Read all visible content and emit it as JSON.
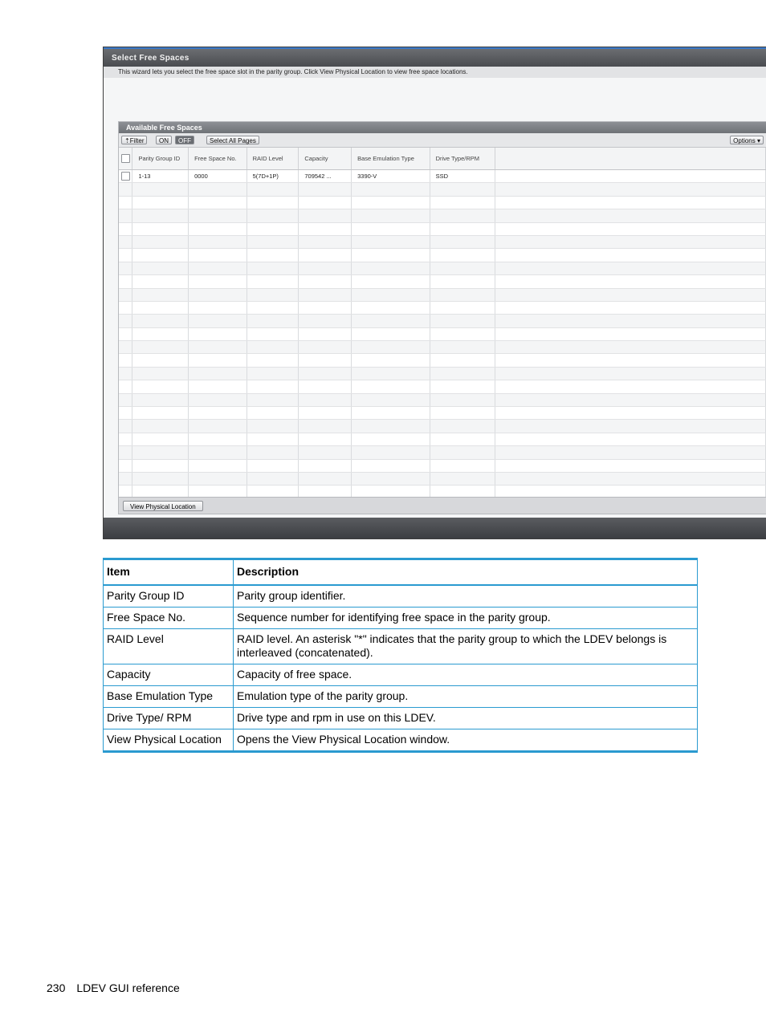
{
  "screenshot": {
    "window_title": "Select Free Spaces",
    "description": "This wizard lets you select the free space slot in the parity group. Click View Physical Location to view free space locations.",
    "panel_title": "Available Free Spaces",
    "toolbar": {
      "filter_label": "Filter",
      "on_label": "ON",
      "off_label": "OFF",
      "select_all_label": "Select All Pages",
      "options_label": "Options"
    },
    "columns": [
      "Parity Group ID",
      "Free Space No.",
      "RAID Level",
      "Capacity",
      "Base Emulation Type",
      "Drive Type/RPM"
    ],
    "rows": [
      [
        "1-13",
        "0000",
        "5(7D+1P)",
        "709542 ...",
        "3390-V",
        "SSD"
      ]
    ],
    "empty_row_count": 24,
    "view_location_label": "View Physical Location"
  },
  "table": {
    "headers": {
      "item": "Item",
      "description": "Description"
    },
    "rows": [
      {
        "item": "Parity Group ID",
        "description": "Parity group identifier."
      },
      {
        "item": "Free Space No.",
        "description": "Sequence number for identifying free space in the parity group."
      },
      {
        "item": "RAID Level",
        "description": "RAID level. An asterisk \"*\" indicates that the parity group to which the LDEV belongs is interleaved (concatenated)."
      },
      {
        "item": "Capacity",
        "description": "Capacity of free space."
      },
      {
        "item": "Base Emulation Type",
        "description": "Emulation type of the parity group."
      },
      {
        "item": "Drive Type/ RPM",
        "description": "Drive type and rpm in use on this LDEV."
      },
      {
        "item": "View Physical Location",
        "description": "Opens the View Physical Location window."
      }
    ]
  },
  "footer": {
    "page_number": "230",
    "section": "LDEV GUI reference"
  },
  "colors": {
    "table_rule": "#2a9ad0",
    "title_bar": "#4a4c50"
  }
}
